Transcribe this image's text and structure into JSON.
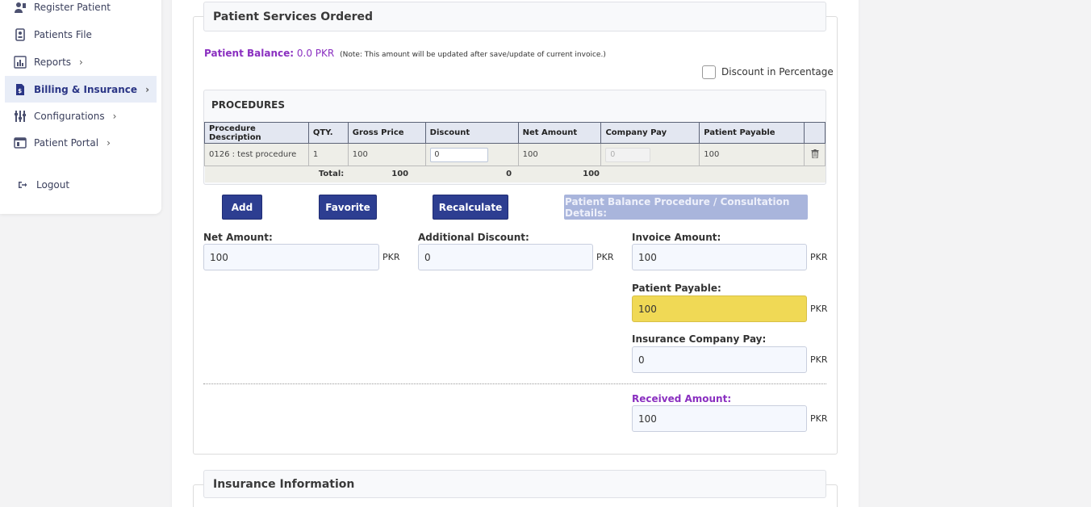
{
  "sidebar": {
    "items": [
      {
        "label": "Register Patient",
        "icon": "user-plus-icon"
      },
      {
        "label": "Patients File",
        "icon": "file-badge-icon"
      },
      {
        "label": "Reports",
        "icon": "chart-icon"
      },
      {
        "label": "Billing & Insurance",
        "icon": "invoice-icon"
      },
      {
        "label": "Configurations",
        "icon": "sliders-icon"
      },
      {
        "label": "Patient Portal",
        "icon": "portal-icon"
      },
      {
        "label": "Logout",
        "icon": "logout-icon"
      }
    ]
  },
  "services": {
    "title": "Patient Services Ordered",
    "balance_label": "Patient Balance:",
    "balance_value": "0.0 PKR",
    "balance_note": "(Note: This amount will be updated after save/update of current invoice.)",
    "discount_pct_label": "Discount in Percentage"
  },
  "procedures": {
    "title": "PROCEDURES",
    "columns": [
      "Procedure Description",
      "QTY.",
      "Gross Price",
      "Discount",
      "Net Amount",
      "Company Pay",
      "Patient Payable"
    ],
    "rows": [
      {
        "description": "0126 : test procedure",
        "qty": "1",
        "gross": "100",
        "discount": "0",
        "net": "100",
        "company_pay": "0",
        "patient_payable": "100"
      }
    ],
    "total": {
      "label": "Total:",
      "gross": "100",
      "discount": "0",
      "net": "100"
    }
  },
  "buttons": {
    "add": "Add",
    "favorite": "Favorite",
    "recalculate": "Recalculate",
    "balance_details": "Patient Balance Procedure / Consultation Details:"
  },
  "form": {
    "currency": "PKR",
    "net_amount_label": "Net Amount:",
    "net_amount": "100",
    "additional_discount_label": "Additional Discount:",
    "additional_discount": "0",
    "invoice_amount_label": "Invoice Amount:",
    "invoice_amount": "100",
    "patient_payable_label": "Patient Payable:",
    "patient_payable": "100",
    "insurance_pay_label": "Insurance Company Pay:",
    "insurance_pay": "0",
    "received_amount_label": "Received Amount:",
    "received_amount": "100"
  },
  "insurance": {
    "title": "Insurance Information"
  },
  "colors": {
    "brand": "#2d3e91",
    "accent_purple": "#8a2fc0",
    "highlight_yellow": "#f0d955"
  }
}
